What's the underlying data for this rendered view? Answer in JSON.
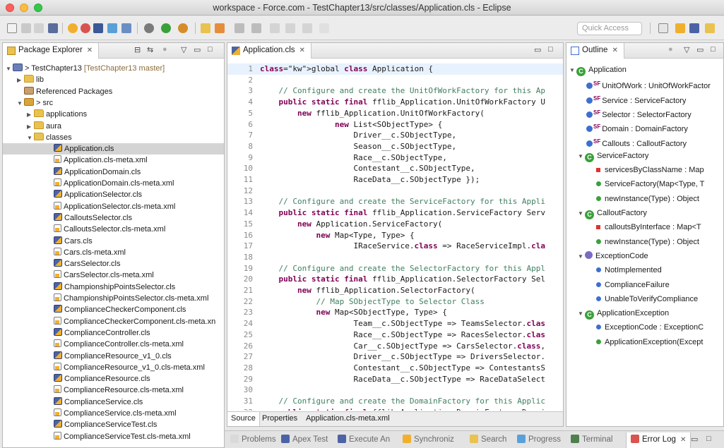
{
  "window": {
    "title": "workspace - Force.com - TestChapter13/src/classes/Application.cls - Eclipse"
  },
  "toolbar": {
    "quick_access_placeholder": "Quick Access"
  },
  "package_explorer": {
    "tab_label": "Package Explorer",
    "close_glyph": "✕",
    "project": {
      "label": "> TestChapter13",
      "git": "[TestChapter13 master]"
    },
    "items": [
      {
        "label": "lib"
      },
      {
        "label": "Referenced Packages"
      },
      {
        "label": "> src"
      },
      {
        "label": "applications"
      },
      {
        "label": "aura"
      },
      {
        "label": "classes"
      },
      {
        "label": "Application.cls"
      },
      {
        "label": "Application.cls-meta.xml"
      },
      {
        "label": "ApplicationDomain.cls"
      },
      {
        "label": "ApplicationDomain.cls-meta.xml"
      },
      {
        "label": "ApplicationSelector.cls"
      },
      {
        "label": "ApplicationSelector.cls-meta.xml"
      },
      {
        "label": "CalloutsSelector.cls"
      },
      {
        "label": "CalloutsSelector.cls-meta.xml"
      },
      {
        "label": "Cars.cls"
      },
      {
        "label": "Cars.cls-meta.xml"
      },
      {
        "label": "CarsSelector.cls"
      },
      {
        "label": "CarsSelector.cls-meta.xml"
      },
      {
        "label": "ChampionshipPointsSelector.cls"
      },
      {
        "label": "ChampionshipPointsSelector.cls-meta.xml"
      },
      {
        "label": "ComplianceCheckerComponent.cls"
      },
      {
        "label": "ComplianceCheckerComponent.cls-meta.xn"
      },
      {
        "label": "ComplianceController.cls"
      },
      {
        "label": "ComplianceController.cls-meta.xml"
      },
      {
        "label": "ComplianceResource_v1_0.cls"
      },
      {
        "label": "ComplianceResource_v1_0.cls-meta.xml"
      },
      {
        "label": "ComplianceResource.cls"
      },
      {
        "label": "ComplianceResource.cls-meta.xml"
      },
      {
        "label": "ComplianceService.cls"
      },
      {
        "label": "ComplianceService.cls-meta.xml"
      },
      {
        "label": "ComplianceServiceTest.cls"
      },
      {
        "label": "ComplianceServiceTest.cls-meta.xml"
      }
    ]
  },
  "editor": {
    "tab_label": "Application.cls",
    "close_glyph": "✕",
    "lines": [
      {
        "n": "1",
        "text": "global class Application {"
      },
      {
        "n": "2",
        "text": ""
      },
      {
        "n": "3",
        "text": "    // Configure and create the UnitOfWorkFactory for this Ap"
      },
      {
        "n": "4",
        "text": "    public static final fflib_Application.UnitOfWorkFactory U"
      },
      {
        "n": "5",
        "text": "        new fflib_Application.UnitOfWorkFactory("
      },
      {
        "n": "6",
        "text": "                new List<SObjectType> {"
      },
      {
        "n": "7",
        "text": "                    Driver__c.SObjectType,"
      },
      {
        "n": "8",
        "text": "                    Season__c.SObjectType,"
      },
      {
        "n": "9",
        "text": "                    Race__c.SObjectType,"
      },
      {
        "n": "10",
        "text": "                    Contestant__c.SObjectType,"
      },
      {
        "n": "11",
        "text": "                    RaceData__c.SObjectType });"
      },
      {
        "n": "12",
        "text": ""
      },
      {
        "n": "13",
        "text": "    // Configure and create the ServiceFactory for this Appli"
      },
      {
        "n": "14",
        "text": "    public static final fflib_Application.ServiceFactory Serv"
      },
      {
        "n": "15",
        "text": "        new Application.ServiceFactory("
      },
      {
        "n": "16",
        "text": "            new Map<Type, Type> {"
      },
      {
        "n": "17",
        "text": "                    IRaceService.class => RaceServiceImpl.cla"
      },
      {
        "n": "18",
        "text": ""
      },
      {
        "n": "19",
        "text": "    // Configure and create the SelectorFactory for this Appl"
      },
      {
        "n": "20",
        "text": "    public static final fflib_Application.SelectorFactory Sel"
      },
      {
        "n": "21",
        "text": "        new fflib_Application.SelectorFactory("
      },
      {
        "n": "22",
        "text": "            // Map SObjectType to Selector Class"
      },
      {
        "n": "23",
        "text": "            new Map<SObjectType, Type> {"
      },
      {
        "n": "24",
        "text": "                    Team__c.SObjectType => TeamsSelector.clas"
      },
      {
        "n": "25",
        "text": "                    Race__c.SObjectType => RacesSelector.clas"
      },
      {
        "n": "26",
        "text": "                    Car__c.SObjectType => CarsSelector.class,"
      },
      {
        "n": "27",
        "text": "                    Driver__c.SObjectType => DriversSelector."
      },
      {
        "n": "28",
        "text": "                    Contestant__c.SObjectType => ContestantsS"
      },
      {
        "n": "29",
        "text": "                    RaceData__c.SObjectType => RaceDataSelect"
      },
      {
        "n": "30",
        "text": ""
      },
      {
        "n": "31",
        "text": "    // Configure and create the DomainFactory for this Applic"
      },
      {
        "n": "32",
        "text": "    public static final fflib_Application.DomainFactory Domai"
      },
      {
        "n": "33",
        "text": "        new fflib_Application.DomainFactory("
      },
      {
        "n": "34",
        "text": "            Application.Selector,"
      }
    ],
    "bottom_tabs": [
      "Source",
      "Properties",
      "Application.cls-meta.xml"
    ]
  },
  "outline": {
    "tab_label": "Outline",
    "close_glyph": "✕",
    "items": [
      {
        "label": "Application"
      },
      {
        "label": "UnitOfWork : UnitOfWorkFactor"
      },
      {
        "label": "Service : ServiceFactory"
      },
      {
        "label": "Selector : SelectorFactory"
      },
      {
        "label": "Domain : DomainFactory"
      },
      {
        "label": "Callouts : CalloutFactory"
      },
      {
        "label": "ServiceFactory"
      },
      {
        "label": "servicesByClassName : Map"
      },
      {
        "label": "ServiceFactory(Map<Type, T"
      },
      {
        "label": "newInstance(Type) : Object"
      },
      {
        "label": "CalloutFactory"
      },
      {
        "label": "calloutsByInterface : Map<T"
      },
      {
        "label": "newInstance(Type) : Object"
      },
      {
        "label": "ExceptionCode"
      },
      {
        "label": "NotImplemented"
      },
      {
        "label": "ComplianceFailure"
      },
      {
        "label": "UnableToVerifyCompliance"
      },
      {
        "label": "ApplicationException"
      },
      {
        "label": "ExceptionCode : ExceptionC"
      },
      {
        "label": "ApplicationException(Except"
      }
    ]
  },
  "bottom_panel": {
    "tabs": [
      "Problems",
      "Apex Test",
      "Execute An",
      "Synchroniz",
      "Search",
      "Progress",
      "Terminal",
      "Error Log"
    ],
    "close_glyph": "✕"
  },
  "icon_colors": {
    "cls": "#4b63a6",
    "folder": "#e9c24f",
    "green": "#3aa13a",
    "blue": "#3d6fd1"
  }
}
